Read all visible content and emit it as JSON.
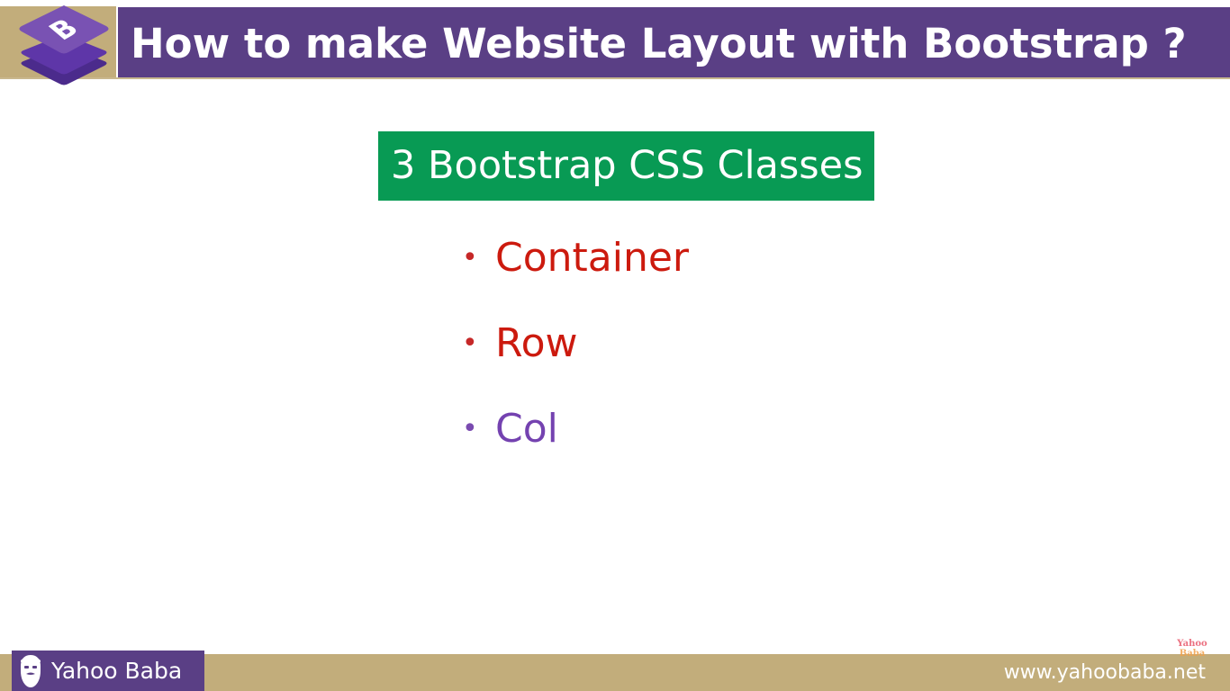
{
  "header": {
    "logo_icon": "bootstrap-logo-icon",
    "logo_letter": "B",
    "title": "How to make Website Layout with Bootstrap ?",
    "colors": {
      "purple": "#5a3f85",
      "tan": "#c2ad7b"
    }
  },
  "content": {
    "heading": "3 Bootstrap CSS Classes",
    "heading_color": "#089a54",
    "bullets": [
      {
        "label": "Container",
        "color": "#cc1a0e"
      },
      {
        "label": "Row",
        "color": "#cc1a0e"
      },
      {
        "label": "Col",
        "color": "#7442b0"
      }
    ]
  },
  "footer": {
    "brand_icon": "bearded-man-icon",
    "brand": "Yahoo Baba",
    "website": "www.yahoobaba.net",
    "watermark_line1": "Yahoo",
    "watermark_line2": "Baba"
  }
}
